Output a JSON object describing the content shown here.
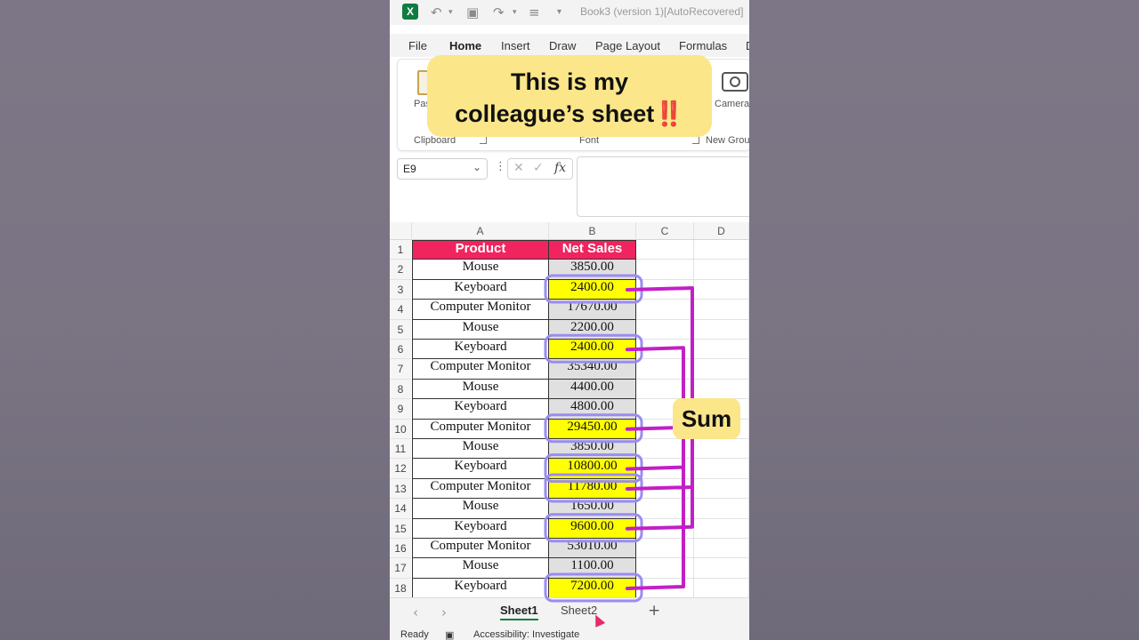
{
  "titlebar": {
    "app_icon": "excel-icon",
    "doc_title": "Book3 (version 1)[AutoRecovered]"
  },
  "menu": [
    "File",
    "Home",
    "Insert",
    "Draw",
    "Page Layout",
    "Formulas",
    "D"
  ],
  "menu_active": "Home",
  "ribbon": {
    "paste_partial": "Pas",
    "camera_label": "Camera",
    "groups": {
      "clipboard": "Clipboard",
      "font": "Font",
      "new_group": "New Grou"
    }
  },
  "formula_bar": {
    "name_box": "E9",
    "formula": ""
  },
  "columns": [
    "A",
    "B",
    "C",
    "D"
  ],
  "table": {
    "headers": [
      "Product",
      "Net Sales"
    ],
    "header_color": "#f0245e",
    "highlight_color": "#ffff00",
    "rows": [
      {
        "n": "2",
        "product": "Mouse",
        "sales": "3850.00",
        "hl": false
      },
      {
        "n": "3",
        "product": "Keyboard",
        "sales": "2400.00",
        "hl": true
      },
      {
        "n": "4",
        "product": "Computer Monitor",
        "sales": "17670.00",
        "hl": false
      },
      {
        "n": "5",
        "product": "Mouse",
        "sales": "2200.00",
        "hl": false
      },
      {
        "n": "6",
        "product": "Keyboard",
        "sales": "2400.00",
        "hl": true
      },
      {
        "n": "7",
        "product": "Computer Monitor",
        "sales": "35340.00",
        "hl": false
      },
      {
        "n": "8",
        "product": "Mouse",
        "sales": "4400.00",
        "hl": false
      },
      {
        "n": "9",
        "product": "Keyboard",
        "sales": "4800.00",
        "hl": false
      },
      {
        "n": "10",
        "product": "Computer Monitor",
        "sales": "29450.00",
        "hl": true
      },
      {
        "n": "11",
        "product": "Mouse",
        "sales": "3850.00",
        "hl": false
      },
      {
        "n": "12",
        "product": "Keyboard",
        "sales": "10800.00",
        "hl": true
      },
      {
        "n": "13",
        "product": "Computer Monitor",
        "sales": "11780.00",
        "hl": true
      },
      {
        "n": "14",
        "product": "Mouse",
        "sales": "1650.00",
        "hl": false
      },
      {
        "n": "15",
        "product": "Keyboard",
        "sales": "9600.00",
        "hl": true
      },
      {
        "n": "16",
        "product": "Computer Monitor",
        "sales": "53010.00",
        "hl": false
      },
      {
        "n": "17",
        "product": "Mouse",
        "sales": "1100.00",
        "hl": false
      },
      {
        "n": "18",
        "product": "Keyboard",
        "sales": "7200.00",
        "hl": true
      }
    ]
  },
  "sheets": [
    "Sheet1",
    "Sheet2"
  ],
  "active_sheet": "Sheet1",
  "status": {
    "ready": "Ready",
    "accessibility": "Accessibility: Investigate"
  },
  "overlay": {
    "caption_line1": "This is my",
    "caption_line2": "colleague’s sheet",
    "caption_emoji": "‼️",
    "sum_label": "Sum",
    "annotation_color": "#c21fc7",
    "circle_color": "#9b8cf0"
  }
}
